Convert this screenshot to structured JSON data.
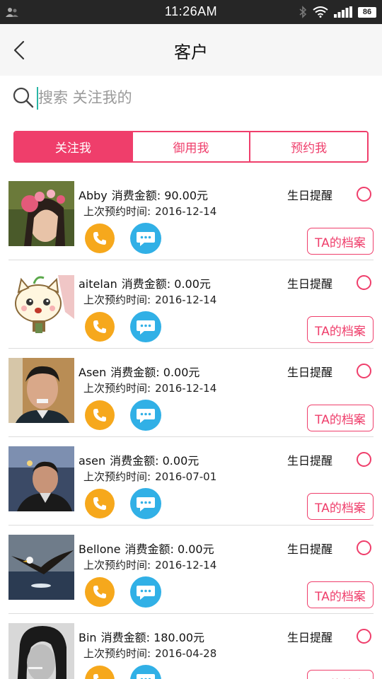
{
  "status_bar": {
    "time": "11:26AM",
    "battery": "86"
  },
  "header": {
    "title": "客户"
  },
  "search": {
    "placeholder": "搜索 关注我的"
  },
  "tabs": [
    {
      "label": "关注我",
      "active": true
    },
    {
      "label": "御用我",
      "active": false
    },
    {
      "label": "预约我",
      "active": false
    }
  ],
  "labels": {
    "spend": "消费金额:",
    "last_appointment": "上次预约时间:",
    "birthday_reminder": "生日提醒",
    "profile_button": "TA的档案"
  },
  "customers": [
    {
      "name": "Abby",
      "amount": "90.00元",
      "last_date": "2016-12-14"
    },
    {
      "name": "aitelan",
      "amount": "0.00元",
      "last_date": "2016-12-14"
    },
    {
      "name": "Asen",
      "amount": "0.00元",
      "last_date": "2016-12-14"
    },
    {
      "name": "asen",
      "amount": "0.00元",
      "last_date": "2016-07-01"
    },
    {
      "name": "Bellone",
      "amount": "0.00元",
      "last_date": "2016-12-14"
    },
    {
      "name": "Bin",
      "amount": "180.00元",
      "last_date": "2016-04-28"
    }
  ],
  "colors": {
    "accent": "#ef3e6b",
    "phone": "#f6a81c",
    "chat": "#31b0e6"
  }
}
